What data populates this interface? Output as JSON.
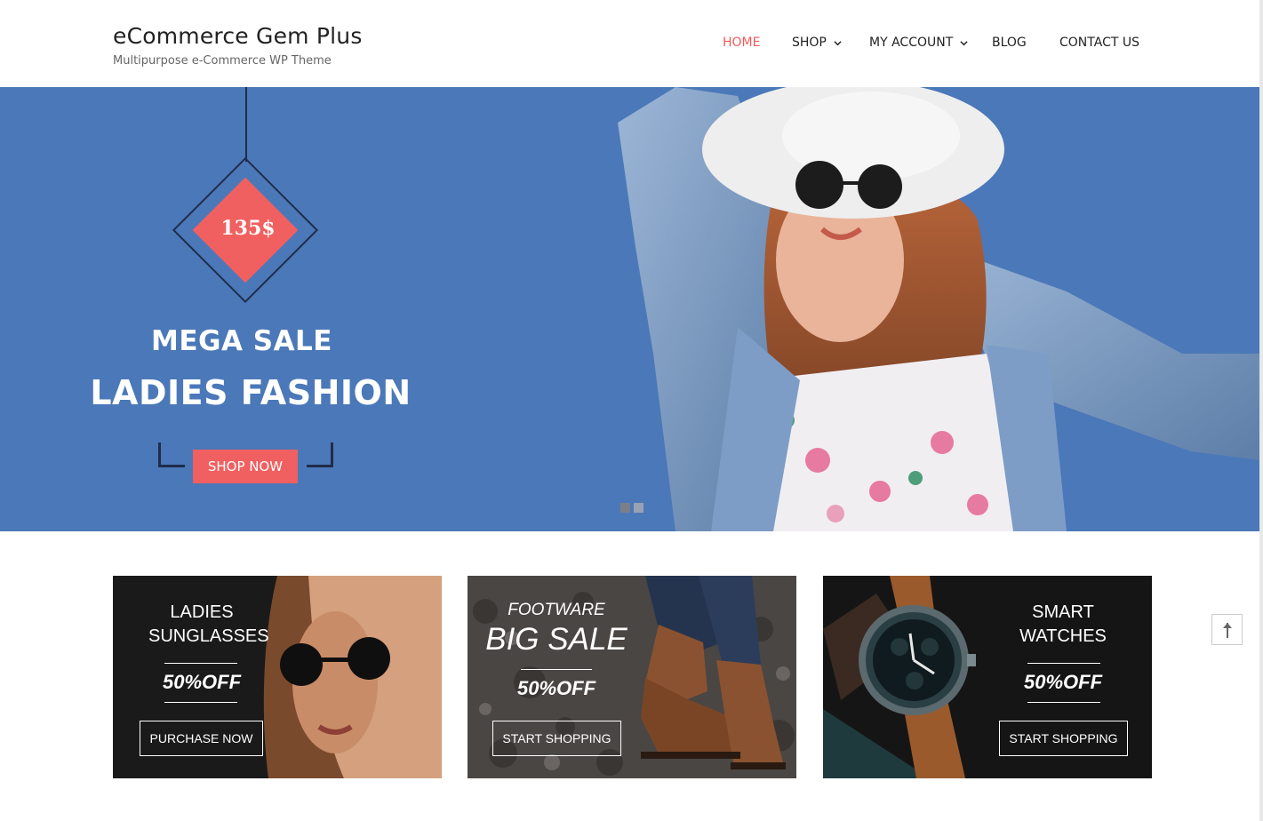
{
  "site": {
    "title": "eCommerce Gem Plus",
    "tagline": "Multipurpose e-Commerce WP Theme"
  },
  "nav": {
    "items": [
      {
        "label": "HOME",
        "active": true,
        "dropdown": false
      },
      {
        "label": "SHOP",
        "active": false,
        "dropdown": true
      },
      {
        "label": "MY ACCOUNT",
        "active": false,
        "dropdown": true
      },
      {
        "label": "BLOG",
        "active": false,
        "dropdown": false
      },
      {
        "label": "CONTACT US",
        "active": false,
        "dropdown": false
      }
    ]
  },
  "hero": {
    "price": "135$",
    "subtitle": "MEGA SALE",
    "title": "LADIES FASHION",
    "button": "SHOP NOW",
    "slides": 2,
    "active_slide": 1
  },
  "cards": [
    {
      "line1": "LADIES",
      "line2": "SUNGLASSES",
      "offer": "50%OFF",
      "button": "PURCHASE NOW"
    },
    {
      "line1": "FOOTWARE",
      "line2": "BIG SALE",
      "offer": "50%OFF",
      "button": "START SHOPPING"
    },
    {
      "line1": "SMART",
      "line2": "WATCHES",
      "offer": "50%OFF",
      "button": "START SHOPPING"
    }
  ],
  "colors": {
    "accent": "#f15a5a",
    "hero_bg": "#4b78b8",
    "navy": "#1f2d4a"
  },
  "icons": {
    "dropdown": "chevron-down-icon",
    "scroll_top": "arrow-up-icon"
  }
}
